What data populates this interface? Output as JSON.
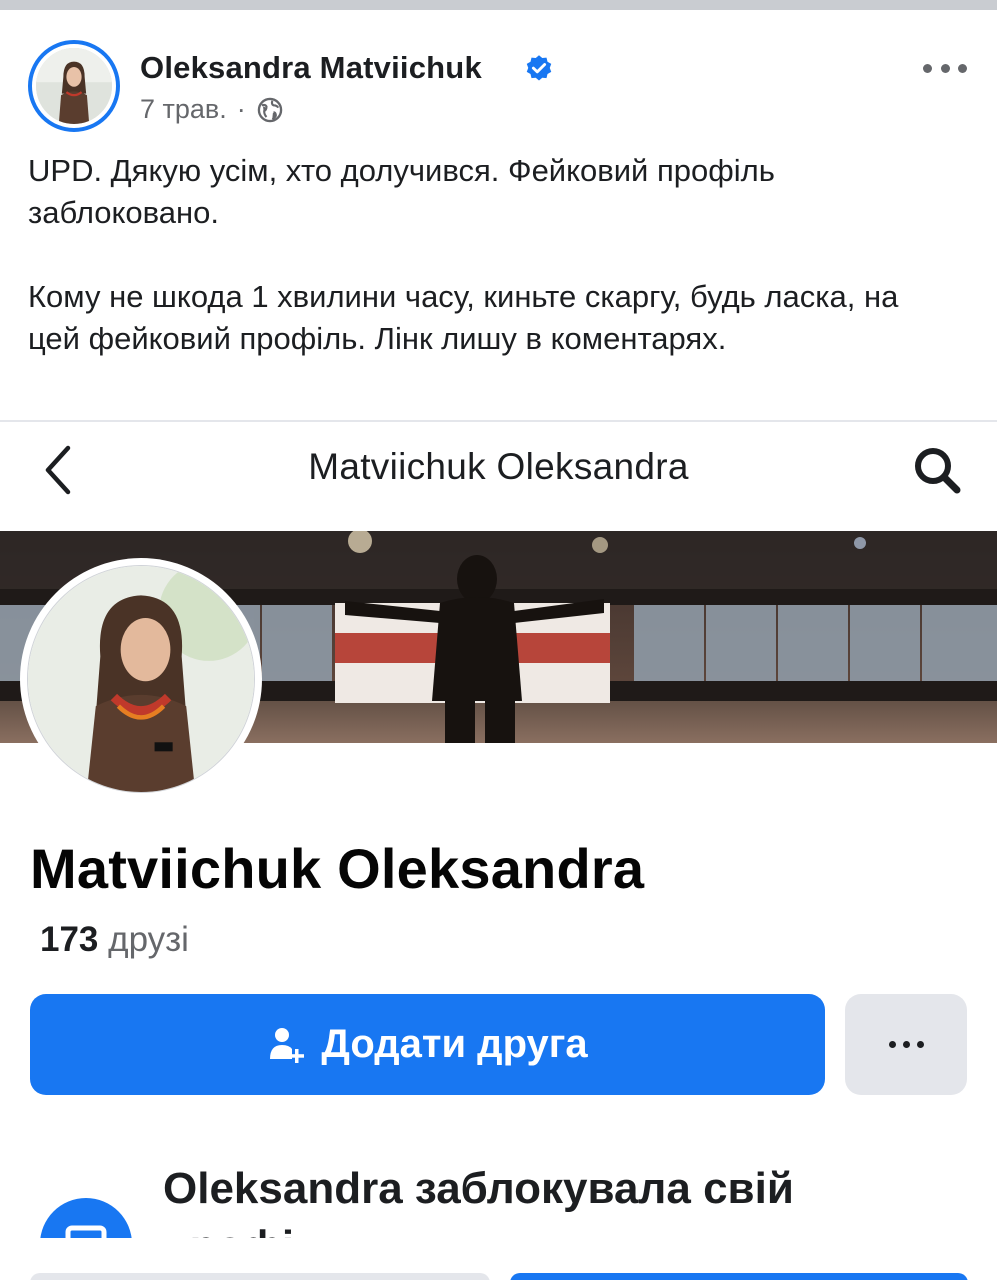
{
  "post": {
    "author": "Oleksandra Matviichuk",
    "date": "7 трав.",
    "separator": "·",
    "paragraphs": [
      "UPD. Дякую усім, хто долучився. Фейковий профіль заблоковано.",
      "Кому не шкода 1 хвилини часу, киньте скаргу, будь ласка, на цей фейковий профіль. Лінк лишу в коментарях."
    ],
    "icons": {
      "verified": "verified-badge-icon",
      "audience": "globe-icon",
      "more": "more-options-icon"
    },
    "accent_color": "#1877f2"
  },
  "screenshot": {
    "header_title": "Matviichuk Oleksandra",
    "profile_name": "Matviichuk Oleksandra",
    "friends_count": "173",
    "friends_label": "друзі",
    "add_friend_label": "Додати друга",
    "locked_message": "Oleksandra заблокувала свій профіль",
    "icons": {
      "back": "chevron-left-icon",
      "search": "search-icon",
      "add_friend": "add-friend-icon",
      "more": "more-icon",
      "lock": "lock-icon"
    },
    "button_color": "#1877f2",
    "secondary_button_color": "#e4e6eb"
  }
}
